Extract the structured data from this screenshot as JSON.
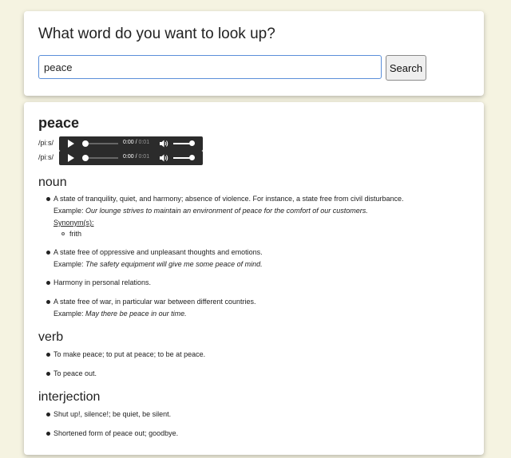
{
  "search": {
    "question": "What word do you want to look up?",
    "input_value": "peace",
    "button_label": "Search"
  },
  "result": {
    "word": "peace",
    "phonetics": [
      {
        "text": "/piːs/",
        "time_current": "0:00",
        "time_duration": "0:01"
      },
      {
        "text": "/piːs/",
        "time_current": "0:00",
        "time_duration": "0:01"
      }
    ],
    "meanings": [
      {
        "part_of_speech": "noun",
        "definitions": [
          {
            "definition": "A state of tranquility, quiet, and harmony; absence of violence. For instance, a state free from civil disturbance.",
            "example_label": "Example:",
            "example": "Our lounge strives to maintain an environment of peace for the comfort of our customers.",
            "synonyms_label": "Synonym(s):",
            "synonyms": [
              "frith"
            ]
          },
          {
            "definition": "A state free of oppressive and unpleasant thoughts and emotions.",
            "example_label": "Example:",
            "example": "The safety equipment will give me some peace of mind."
          },
          {
            "definition": "Harmony in personal relations."
          },
          {
            "definition": "A state free of war, in particular war between different countries.",
            "example_label": "Example:",
            "example": "May there be peace in our time."
          }
        ]
      },
      {
        "part_of_speech": "verb",
        "definitions": [
          {
            "definition": "To make peace; to put at peace; to be at peace."
          },
          {
            "definition": "To peace out."
          }
        ]
      },
      {
        "part_of_speech": "interjection",
        "definitions": [
          {
            "definition": "Shut up!, silence!; be quiet, be silent."
          },
          {
            "definition": "Shortened form of peace out; goodbye."
          }
        ]
      }
    ]
  }
}
